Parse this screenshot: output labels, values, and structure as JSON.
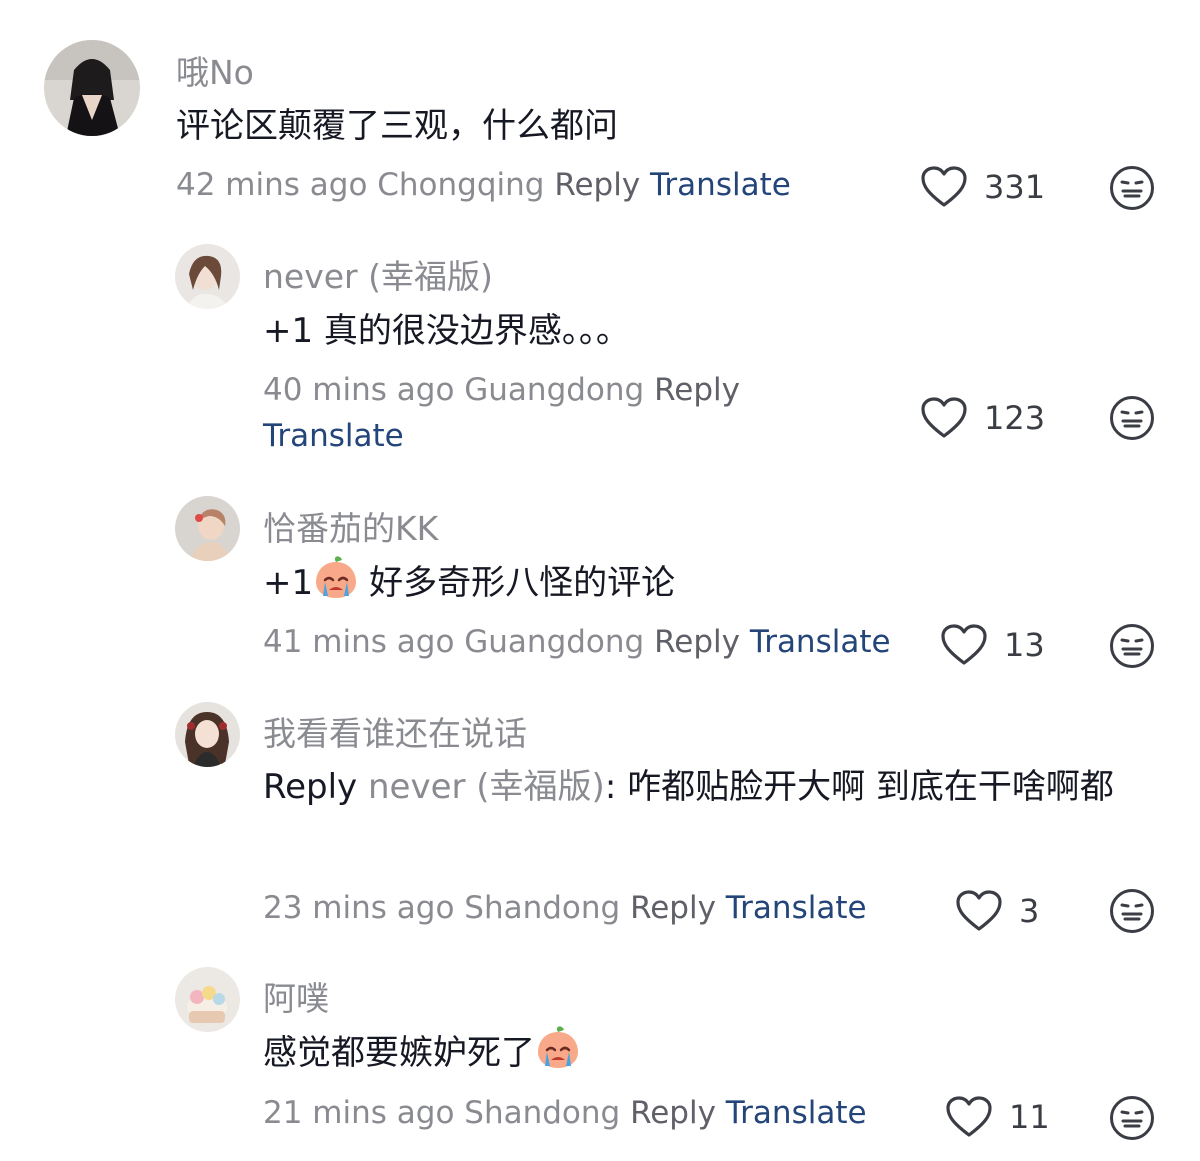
{
  "comments": [
    {
      "username": "哦No",
      "text": "评论区颠覆了三观，什么都问",
      "time": "42 mins ago",
      "location": "Chongqing",
      "reply_label": "Reply",
      "translate_label": "Translate",
      "likes": "331"
    },
    {
      "username": "never (幸福版)",
      "text": "+1 真的很没边界感。。。",
      "time": "40 mins ago",
      "location": "Guangdong",
      "reply_label": "Reply",
      "translate_label": "Translate",
      "likes": "123"
    },
    {
      "username": "恰番茄的KK",
      "text_prefix": "+1",
      "emoji": "crying-peach-emoji",
      "text": "好多奇形八怪的评论",
      "time": "41 mins ago",
      "location": "Guangdong",
      "reply_label": "Reply",
      "translate_label": "Translate",
      "likes": "13"
    },
    {
      "username": "我看看谁还在说话",
      "reply_prefix": "Reply",
      "reply_to": "never (幸福版)",
      "text": ": 咋都贴脸开大啊 到底在干啥啊都",
      "time": "23 mins ago",
      "location": "Shandong",
      "reply_label": "Reply",
      "translate_label": "Translate",
      "likes": "3"
    },
    {
      "username": "阿噗",
      "text": "感觉都要嫉妒死了",
      "emoji": "crying-peach-emoji",
      "time": "21 mins ago",
      "location": "Shandong",
      "reply_label": "Reply",
      "translate_label": "Translate",
      "likes": "11"
    }
  ],
  "icons": {
    "like": "heart-outline-icon",
    "dislike": "neutral-face-icon"
  },
  "colors": {
    "username": "#8a8b91",
    "text": "#161823",
    "translate": "#24457a",
    "background": "#ffffff"
  }
}
